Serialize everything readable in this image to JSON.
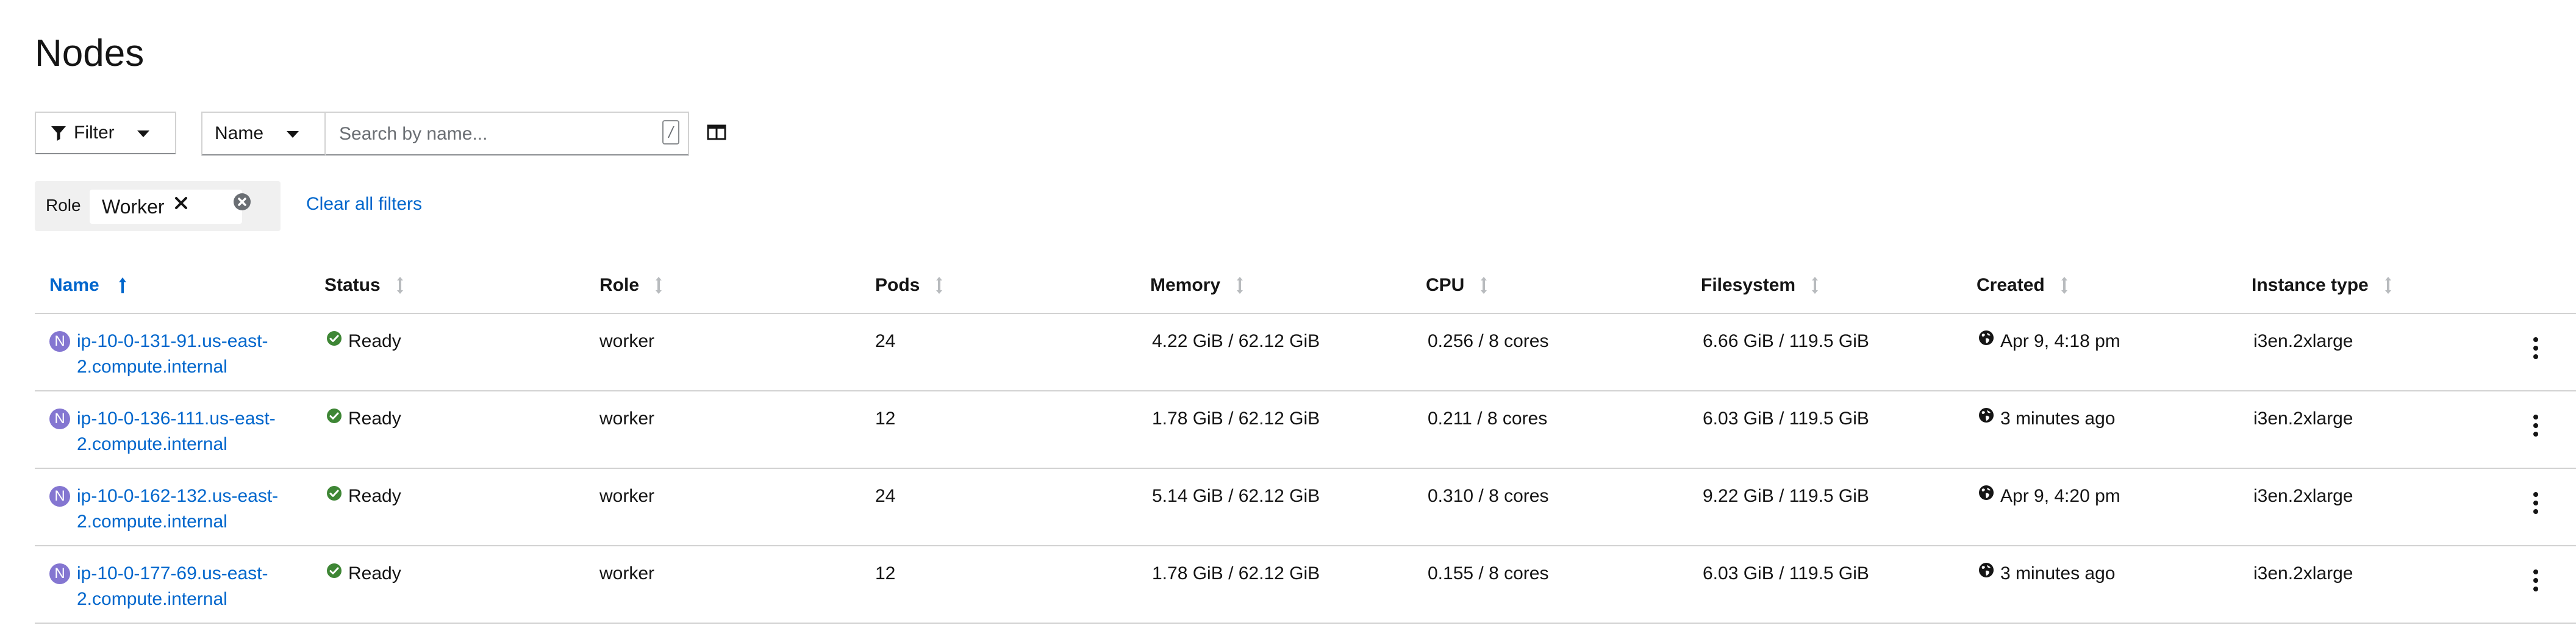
{
  "page": {
    "title": "Nodes"
  },
  "toolbar": {
    "filter_label": "Filter",
    "filter_type_label": "Name",
    "search_placeholder": "Search by name...",
    "search_value": "",
    "shortcut_key": "/"
  },
  "chips": {
    "category": "Role",
    "items": [
      {
        "label": "Worker"
      }
    ],
    "clear_all_label": "Clear all filters"
  },
  "table": {
    "columns": [
      {
        "label": "Name",
        "sorted": "asc"
      },
      {
        "label": "Status"
      },
      {
        "label": "Role"
      },
      {
        "label": "Pods"
      },
      {
        "label": "Memory"
      },
      {
        "label": "CPU"
      },
      {
        "label": "Filesystem"
      },
      {
        "label": "Created"
      },
      {
        "label": "Instance type"
      }
    ],
    "rows": [
      {
        "badge": "N",
        "name_line1": "ip-10-0-131-91.us-east-",
        "name_line2": "2.compute.internal",
        "status": "Ready",
        "role": "worker",
        "pods": "24",
        "memory": "4.22 GiB / 62.12 GiB",
        "cpu": "0.256 / 8 cores",
        "filesystem": "6.66 GiB / 119.5 GiB",
        "created": "Apr 9, 4:18 pm",
        "instance_type": "i3en.2xlarge"
      },
      {
        "badge": "N",
        "name_line1": "ip-10-0-136-111.us-east-",
        "name_line2": "2.compute.internal",
        "status": "Ready",
        "role": "worker",
        "pods": "12",
        "memory": "1.78 GiB / 62.12 GiB",
        "cpu": "0.211 / 8 cores",
        "filesystem": "6.03 GiB / 119.5 GiB",
        "created": "3 minutes ago",
        "instance_type": "i3en.2xlarge"
      },
      {
        "badge": "N",
        "name_line1": "ip-10-0-162-132.us-east-",
        "name_line2": "2.compute.internal",
        "status": "Ready",
        "role": "worker",
        "pods": "24",
        "memory": "5.14 GiB / 62.12 GiB",
        "cpu": "0.310 / 8 cores",
        "filesystem": "9.22 GiB / 119.5 GiB",
        "created": "Apr 9, 4:20 pm",
        "instance_type": "i3en.2xlarge"
      },
      {
        "badge": "N",
        "name_line1": "ip-10-0-177-69.us-east-",
        "name_line2": "2.compute.internal",
        "status": "Ready",
        "role": "worker",
        "pods": "12",
        "memory": "1.78 GiB / 62.12 GiB",
        "cpu": "0.155 / 8 cores",
        "filesystem": "6.03 GiB / 119.5 GiB",
        "created": "3 minutes ago",
        "instance_type": "i3en.2xlarge"
      }
    ]
  },
  "colors": {
    "link": "#0066cc",
    "status_ok": "#3e8635",
    "node_badge": "#8476d1",
    "chip_group_bg": "#f0f0f0",
    "border": "#d2d2d2"
  },
  "icons": {
    "filter": "funnel-icon",
    "columns": "columns-icon",
    "status": "check-circle-icon",
    "created": "globe-icon",
    "row_actions": "kebab-icon"
  }
}
